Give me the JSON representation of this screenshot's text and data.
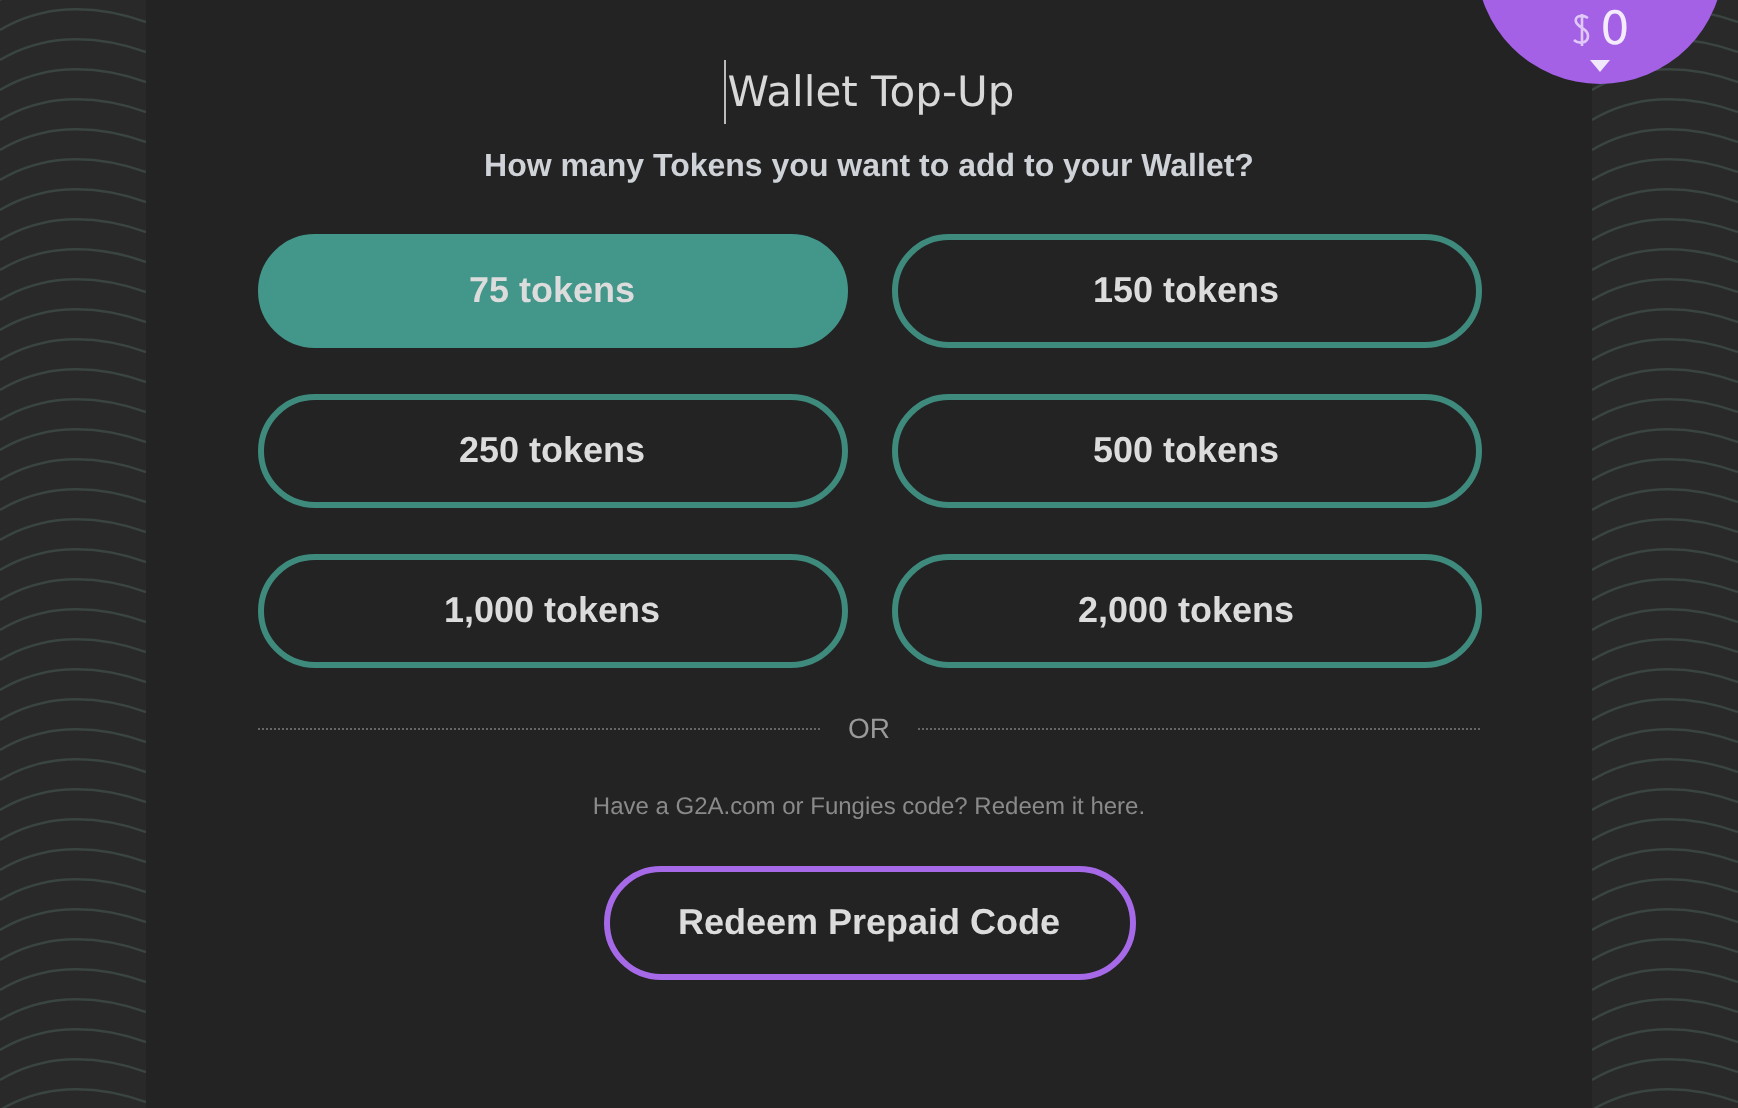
{
  "balance_badge": {
    "amount": "0"
  },
  "title": "Wallet Top-Up",
  "question": "How many Tokens you want to add to your Wallet?",
  "token_options": [
    {
      "label": "75 tokens",
      "selected": true
    },
    {
      "label": "150 tokens",
      "selected": false
    },
    {
      "label": "250 tokens",
      "selected": false
    },
    {
      "label": "500 tokens",
      "selected": false
    },
    {
      "label": "1,000 tokens",
      "selected": false
    },
    {
      "label": "2,000 tokens",
      "selected": false
    }
  ],
  "divider_label": "OR",
  "redeem_hint": "Have a G2A.com or Fungies code? Redeem it here.",
  "redeem_button": "Redeem Prepaid Code"
}
